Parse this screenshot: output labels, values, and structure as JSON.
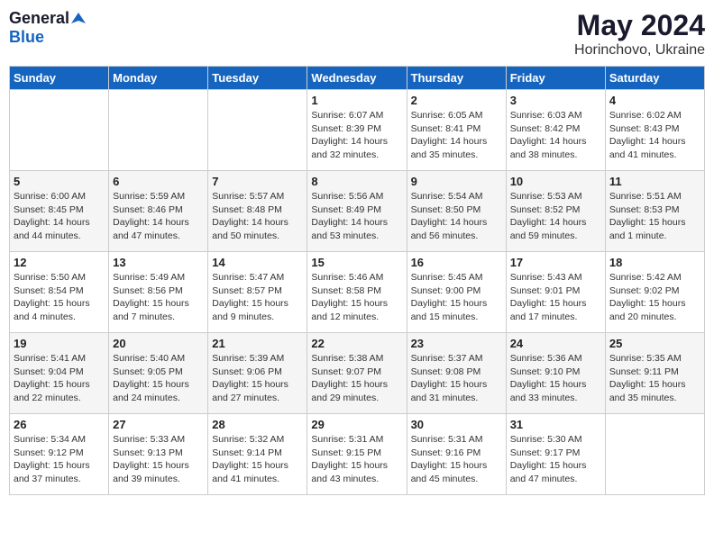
{
  "logo": {
    "general": "General",
    "blue": "Blue"
  },
  "title": {
    "month_year": "May 2024",
    "location": "Horinchovo, Ukraine"
  },
  "weekdays": [
    "Sunday",
    "Monday",
    "Tuesday",
    "Wednesday",
    "Thursday",
    "Friday",
    "Saturday"
  ],
  "weeks": [
    [
      {
        "day": "",
        "info": ""
      },
      {
        "day": "",
        "info": ""
      },
      {
        "day": "",
        "info": ""
      },
      {
        "day": "1",
        "info": "Sunrise: 6:07 AM\nSunset: 8:39 PM\nDaylight: 14 hours\nand 32 minutes."
      },
      {
        "day": "2",
        "info": "Sunrise: 6:05 AM\nSunset: 8:41 PM\nDaylight: 14 hours\nand 35 minutes."
      },
      {
        "day": "3",
        "info": "Sunrise: 6:03 AM\nSunset: 8:42 PM\nDaylight: 14 hours\nand 38 minutes."
      },
      {
        "day": "4",
        "info": "Sunrise: 6:02 AM\nSunset: 8:43 PM\nDaylight: 14 hours\nand 41 minutes."
      }
    ],
    [
      {
        "day": "5",
        "info": "Sunrise: 6:00 AM\nSunset: 8:45 PM\nDaylight: 14 hours\nand 44 minutes."
      },
      {
        "day": "6",
        "info": "Sunrise: 5:59 AM\nSunset: 8:46 PM\nDaylight: 14 hours\nand 47 minutes."
      },
      {
        "day": "7",
        "info": "Sunrise: 5:57 AM\nSunset: 8:48 PM\nDaylight: 14 hours\nand 50 minutes."
      },
      {
        "day": "8",
        "info": "Sunrise: 5:56 AM\nSunset: 8:49 PM\nDaylight: 14 hours\nand 53 minutes."
      },
      {
        "day": "9",
        "info": "Sunrise: 5:54 AM\nSunset: 8:50 PM\nDaylight: 14 hours\nand 56 minutes."
      },
      {
        "day": "10",
        "info": "Sunrise: 5:53 AM\nSunset: 8:52 PM\nDaylight: 14 hours\nand 59 minutes."
      },
      {
        "day": "11",
        "info": "Sunrise: 5:51 AM\nSunset: 8:53 PM\nDaylight: 15 hours\nand 1 minute."
      }
    ],
    [
      {
        "day": "12",
        "info": "Sunrise: 5:50 AM\nSunset: 8:54 PM\nDaylight: 15 hours\nand 4 minutes."
      },
      {
        "day": "13",
        "info": "Sunrise: 5:49 AM\nSunset: 8:56 PM\nDaylight: 15 hours\nand 7 minutes."
      },
      {
        "day": "14",
        "info": "Sunrise: 5:47 AM\nSunset: 8:57 PM\nDaylight: 15 hours\nand 9 minutes."
      },
      {
        "day": "15",
        "info": "Sunrise: 5:46 AM\nSunset: 8:58 PM\nDaylight: 15 hours\nand 12 minutes."
      },
      {
        "day": "16",
        "info": "Sunrise: 5:45 AM\nSunset: 9:00 PM\nDaylight: 15 hours\nand 15 minutes."
      },
      {
        "day": "17",
        "info": "Sunrise: 5:43 AM\nSunset: 9:01 PM\nDaylight: 15 hours\nand 17 minutes."
      },
      {
        "day": "18",
        "info": "Sunrise: 5:42 AM\nSunset: 9:02 PM\nDaylight: 15 hours\nand 20 minutes."
      }
    ],
    [
      {
        "day": "19",
        "info": "Sunrise: 5:41 AM\nSunset: 9:04 PM\nDaylight: 15 hours\nand 22 minutes."
      },
      {
        "day": "20",
        "info": "Sunrise: 5:40 AM\nSunset: 9:05 PM\nDaylight: 15 hours\nand 24 minutes."
      },
      {
        "day": "21",
        "info": "Sunrise: 5:39 AM\nSunset: 9:06 PM\nDaylight: 15 hours\nand 27 minutes."
      },
      {
        "day": "22",
        "info": "Sunrise: 5:38 AM\nSunset: 9:07 PM\nDaylight: 15 hours\nand 29 minutes."
      },
      {
        "day": "23",
        "info": "Sunrise: 5:37 AM\nSunset: 9:08 PM\nDaylight: 15 hours\nand 31 minutes."
      },
      {
        "day": "24",
        "info": "Sunrise: 5:36 AM\nSunset: 9:10 PM\nDaylight: 15 hours\nand 33 minutes."
      },
      {
        "day": "25",
        "info": "Sunrise: 5:35 AM\nSunset: 9:11 PM\nDaylight: 15 hours\nand 35 minutes."
      }
    ],
    [
      {
        "day": "26",
        "info": "Sunrise: 5:34 AM\nSunset: 9:12 PM\nDaylight: 15 hours\nand 37 minutes."
      },
      {
        "day": "27",
        "info": "Sunrise: 5:33 AM\nSunset: 9:13 PM\nDaylight: 15 hours\nand 39 minutes."
      },
      {
        "day": "28",
        "info": "Sunrise: 5:32 AM\nSunset: 9:14 PM\nDaylight: 15 hours\nand 41 minutes."
      },
      {
        "day": "29",
        "info": "Sunrise: 5:31 AM\nSunset: 9:15 PM\nDaylight: 15 hours\nand 43 minutes."
      },
      {
        "day": "30",
        "info": "Sunrise: 5:31 AM\nSunset: 9:16 PM\nDaylight: 15 hours\nand 45 minutes."
      },
      {
        "day": "31",
        "info": "Sunrise: 5:30 AM\nSunset: 9:17 PM\nDaylight: 15 hours\nand 47 minutes."
      },
      {
        "day": "",
        "info": ""
      }
    ]
  ]
}
